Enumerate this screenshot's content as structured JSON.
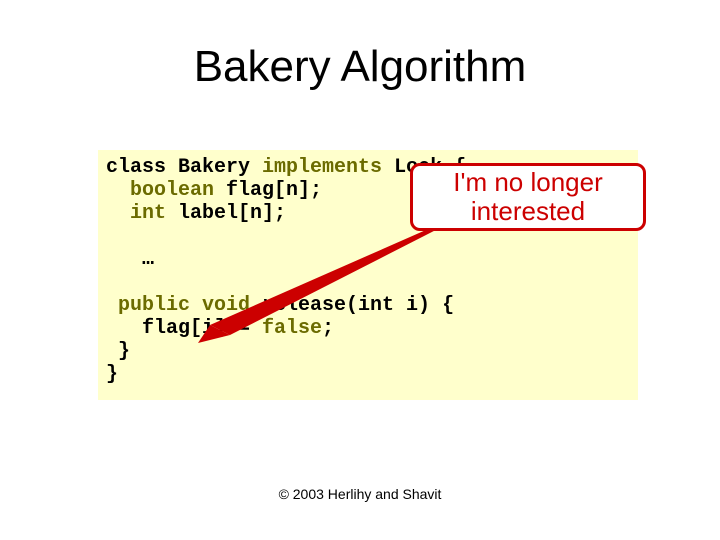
{
  "title": "Bakery Algorithm",
  "code": {
    "l1a": "class Bakery ",
    "l1b": "implements",
    "l1c": " Lock {",
    "l2a": "  boolean",
    "l2b": " flag[n];",
    "l3a": "  int",
    "l3b": " label[n];",
    "l4": "",
    "l5": "   …",
    "l6": "",
    "l7a": " public void",
    "l7b": " release",
    "l7c": "(int i) {",
    "l8a": "   flag[i] = ",
    "l8b": "false",
    "l8c": ";",
    "l9": " }",
    "l10": "}"
  },
  "callout": "I'm no longer interested",
  "footer": "© 2003 Herlihy and Shavit"
}
